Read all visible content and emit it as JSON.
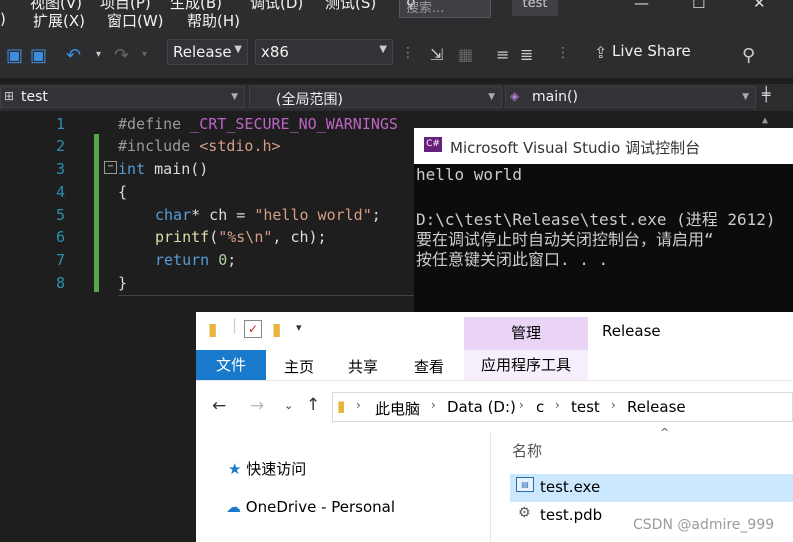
{
  "menu": {
    "items_partial": [
      "视图(V)",
      "项目(P)",
      "生成(B)",
      "调试(D)",
      "测试(S)"
    ],
    "items": [
      ")",
      "扩展(X)",
      "窗口(W)",
      "帮助(H)"
    ],
    "search_placeholder": "搜索...",
    "solution_badge": "test",
    "window_buttons": [
      "—",
      "☐",
      "✕"
    ]
  },
  "toolbar": {
    "config": "Release",
    "platform": "x86",
    "live_share": "Live Share"
  },
  "navbar": {
    "project": "test",
    "scope": "(全局范围)",
    "member": "main()"
  },
  "editor": {
    "line_numbers": [
      "1",
      "2",
      "3",
      "4",
      "5",
      "6",
      "7",
      "8"
    ],
    "lines": [
      {
        "a": "#define ",
        "b": "_CRT_SECURE_NO_WARNINGS"
      },
      {
        "a": "#include ",
        "b": "<stdio.h>"
      },
      {
        "a": "int",
        "b": " main()"
      },
      {
        "a": "{"
      },
      {
        "a": "char",
        "b": "* ch = ",
        "c": "\"hello world\"",
        "d": ";"
      },
      {
        "a": "printf",
        "b": "(",
        "c": "\"%s\\n\"",
        "d": ", ch);"
      },
      {
        "a": "return",
        "b": " ",
        "c": "0",
        "d": ";"
      },
      {
        "a": "}"
      }
    ]
  },
  "console": {
    "title": "Microsoft Visual Studio 调试控制台",
    "icon_text": "C#",
    "lines": [
      "hello world",
      "",
      "D:\\c\\test\\Release\\test.exe (进程 2612)",
      "要在调试停止时自动关闭控制台，请启用“",
      "按任意键关闭此窗口. . ."
    ]
  },
  "explorer": {
    "manage_tab": "管理",
    "window_title": "Release",
    "tabs": {
      "file": "文件",
      "home": "主页",
      "share": "共享",
      "view": "查看",
      "app_tools": "应用程序工具"
    },
    "breadcrumb": [
      "此电脑",
      "Data (D:)",
      "c",
      "test",
      "Release"
    ],
    "nav_items": [
      "快速访问",
      "OneDrive - Personal"
    ],
    "column_header": "名称",
    "files": [
      "test.exe",
      "test.pdb"
    ]
  },
  "watermark": "CSDN @admire_999",
  "colors": {
    "vs_bg": "#1e1e1e",
    "vs_chrome": "#2d2d30",
    "accent_blue": "#1979ca",
    "manage_purple": "#e9d4f5",
    "selection": "#cce8ff"
  }
}
